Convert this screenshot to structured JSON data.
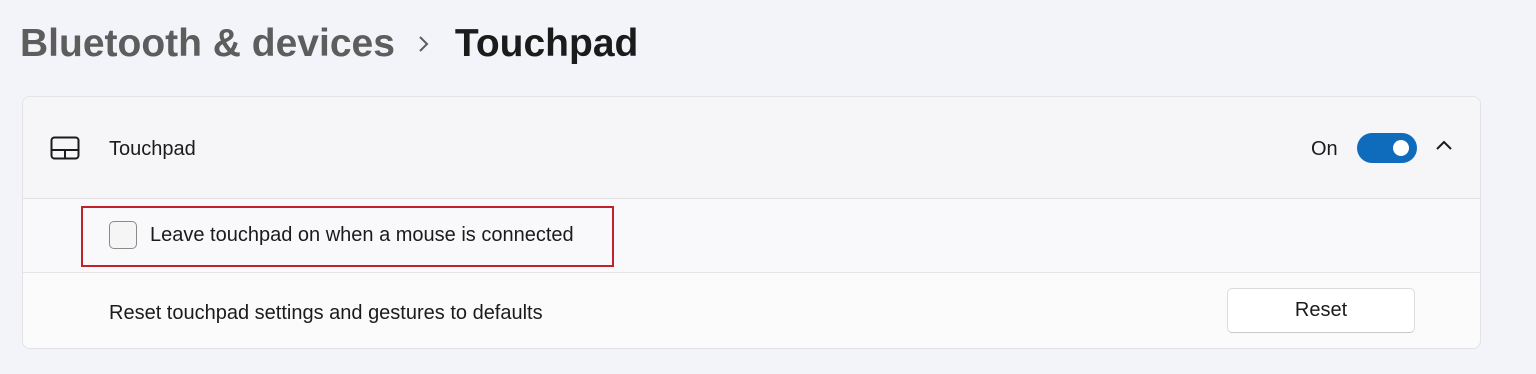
{
  "breadcrumb": {
    "parent": "Bluetooth & devices",
    "separator_icon": "chevron-right-icon",
    "current": "Touchpad"
  },
  "touchpad_card": {
    "icon": "touchpad-icon",
    "label": "Touchpad",
    "toggle_state_label": "On",
    "toggle_on": true,
    "expand_icon": "chevron-up-icon",
    "options": {
      "leave_on_label": "Leave touchpad on when a mouse is connected",
      "leave_on_checked": false
    },
    "reset": {
      "label": "Reset touchpad settings and gestures to defaults",
      "button_label": "Reset"
    }
  },
  "colors": {
    "accent": "#0f6cbd",
    "highlight": "#c0222a",
    "background": "#f3f4f9"
  }
}
